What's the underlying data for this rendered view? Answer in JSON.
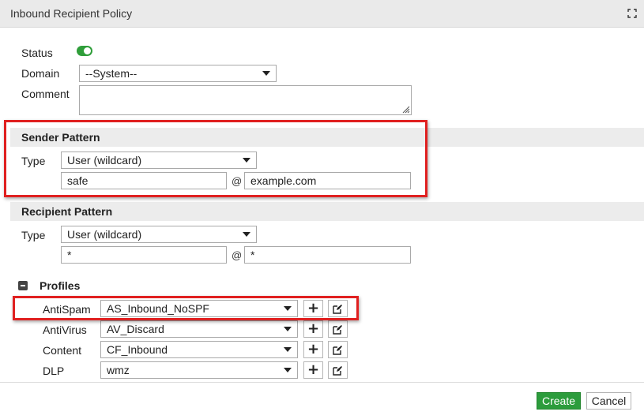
{
  "dialog": {
    "title": "Inbound Recipient Policy"
  },
  "general": {
    "status_label": "Status",
    "status_enabled": true,
    "domain_label": "Domain",
    "domain_value": "--System--",
    "comment_label": "Comment",
    "comment_value": ""
  },
  "sender_pattern": {
    "header": "Sender Pattern",
    "type_label": "Type",
    "type_value": "User (wildcard)",
    "user_value": "safe",
    "at_sign": "@",
    "domain_value": "example.com"
  },
  "recipient_pattern": {
    "header": "Recipient Pattern",
    "type_label": "Type",
    "type_value": "User (wildcard)",
    "user_value": "*",
    "at_sign": "@",
    "domain_value": "*"
  },
  "profiles": {
    "header": "Profiles",
    "rows": [
      {
        "label": "AntiSpam",
        "value": "AS_Inbound_NoSPF"
      },
      {
        "label": "AntiVirus",
        "value": "AV_Discard"
      },
      {
        "label": "Content",
        "value": "CF_Inbound"
      },
      {
        "label": "DLP",
        "value": "wmz"
      }
    ]
  },
  "footer": {
    "create_label": "Create",
    "cancel_label": "Cancel"
  },
  "colors": {
    "accent_green": "#2c9c3c",
    "highlight_red": "#e02020",
    "header_gray": "#ececec"
  },
  "icons": {
    "maximize": "maximize-icon",
    "toggle": "toggle-switch",
    "collapse": "collapse-icon",
    "add": "plus-icon",
    "edit": "edit-icon"
  }
}
